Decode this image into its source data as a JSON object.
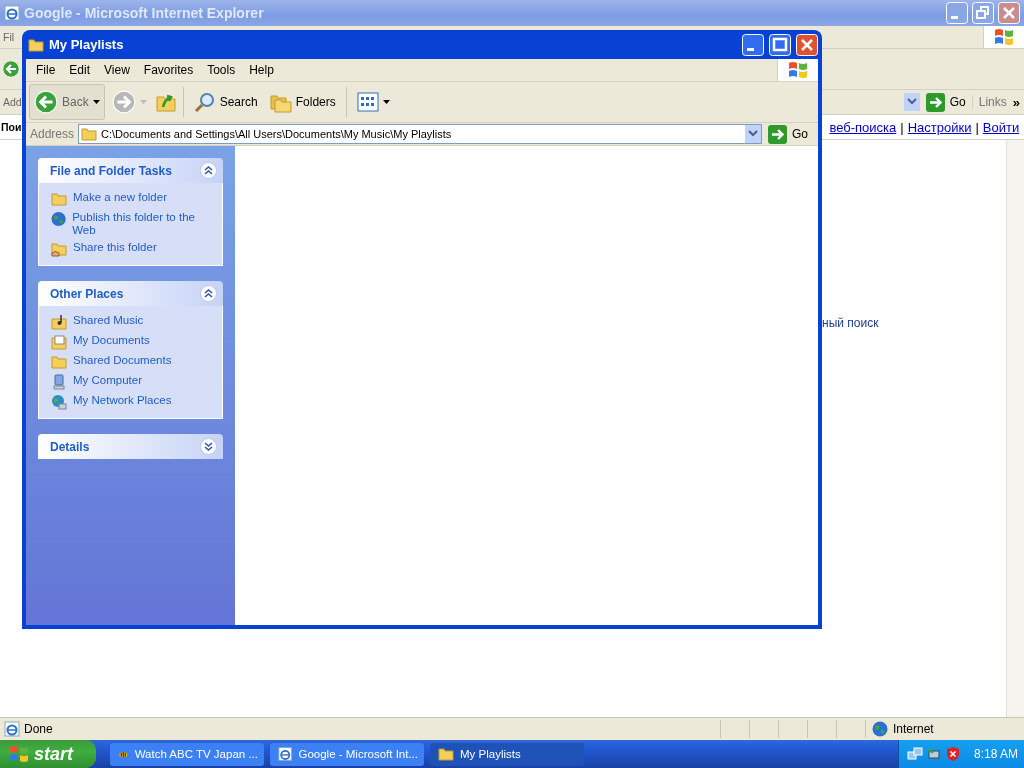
{
  "ie_window": {
    "title": "Google - Microsoft Internet Explorer",
    "menu_fragment": "Fil",
    "address_fragment": "Add",
    "go_label": "Go",
    "links_label": "Links",
    "chevron": "»",
    "page_fragment": "Пои",
    "page_links": [
      {
        "text": "веб-поиска"
      },
      {
        "text": "Настройки"
      },
      {
        "text": "Войти"
      }
    ],
    "separator": "|",
    "page_text_fragment": "ный поиск",
    "status": "Done",
    "zone": "Internet"
  },
  "explorer": {
    "title": "My Playlists",
    "menu": [
      "File",
      "Edit",
      "View",
      "Favorites",
      "Tools",
      "Help"
    ],
    "toolbar": {
      "back": "Back",
      "search": "Search",
      "folders": "Folders"
    },
    "address": {
      "label": "Address",
      "value": "C:\\Documents and Settings\\All Users\\Documents\\My Music\\My Playlists",
      "go": "Go"
    },
    "panels": [
      {
        "title": "File and Folder Tasks",
        "expanded": true,
        "items": [
          {
            "label": "Make a new folder",
            "kind": "new-folder"
          },
          {
            "label": "Publish this folder to the Web",
            "kind": "publish"
          },
          {
            "label": "Share this folder",
            "kind": "share"
          }
        ]
      },
      {
        "title": "Other Places",
        "expanded": true,
        "items": [
          {
            "label": "Shared Music",
            "kind": "music"
          },
          {
            "label": "My Documents",
            "kind": "documents"
          },
          {
            "label": "Shared Documents",
            "kind": "folder"
          },
          {
            "label": "My Computer",
            "kind": "computer"
          },
          {
            "label": "My Network Places",
            "kind": "network"
          }
        ]
      },
      {
        "title": "Details",
        "expanded": false
      }
    ]
  },
  "taskbar": {
    "start": "start",
    "buttons": [
      {
        "label": "Watch ABC TV Japan ...",
        "kind": "bee",
        "selected": false
      },
      {
        "label": "Google - Microsoft Int...",
        "kind": "ie",
        "selected": false
      },
      {
        "label": "My Playlists",
        "kind": "folder",
        "selected": true
      }
    ],
    "clock": "8:18 AM"
  }
}
